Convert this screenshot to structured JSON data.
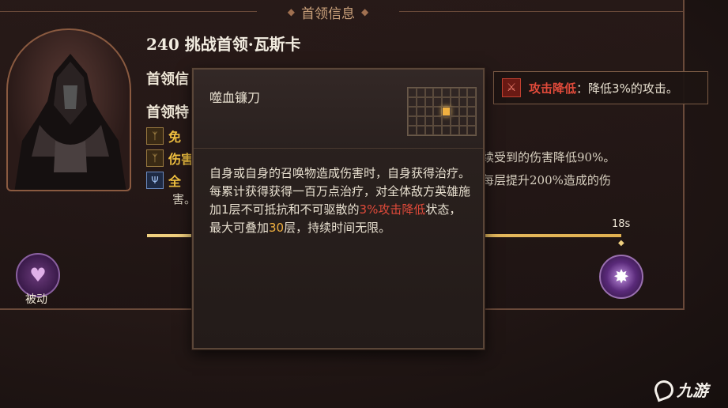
{
  "panel": {
    "title": "首领信息"
  },
  "boss": {
    "title": "240 挑战首领·瓦斯卡",
    "section_info": "首领信",
    "section_traits": "首领特"
  },
  "traits": [
    {
      "icon": "claw-icon",
      "label": "免",
      "color": "#f0c040"
    },
    {
      "icon": "claw-icon",
      "label": "伤害",
      "color": "#f0c040"
    },
    {
      "icon": "trident-icon",
      "label": "全",
      "color": "#f0c040"
    }
  ],
  "right_texts": {
    "line1": "续受到的伤害降低90%。",
    "line2": "每层提升200%造成的伤",
    "line3": "害。"
  },
  "debuff": {
    "name": "攻击降低",
    "colon": "：",
    "desc": "降低3%的攻击。",
    "color": "#e04a3a"
  },
  "timeline": {
    "time": "18s"
  },
  "passive": {
    "label": "被动"
  },
  "tooltip": {
    "name": "噬血镰刀",
    "grid_active": [
      20
    ],
    "body_part1": "自身或自身的召唤物造成伤害时，自身获得治疗。每累计获得获得一百万点治疗，对全体敌方英雄施加1层不可抵抗和不可驱散的",
    "body_highlight1": "3%攻击降低",
    "body_part2": "状态，最大可叠加",
    "body_highlight2": "30",
    "body_part3": "层，持续时间无限。"
  },
  "watermark": {
    "text": "九游"
  }
}
